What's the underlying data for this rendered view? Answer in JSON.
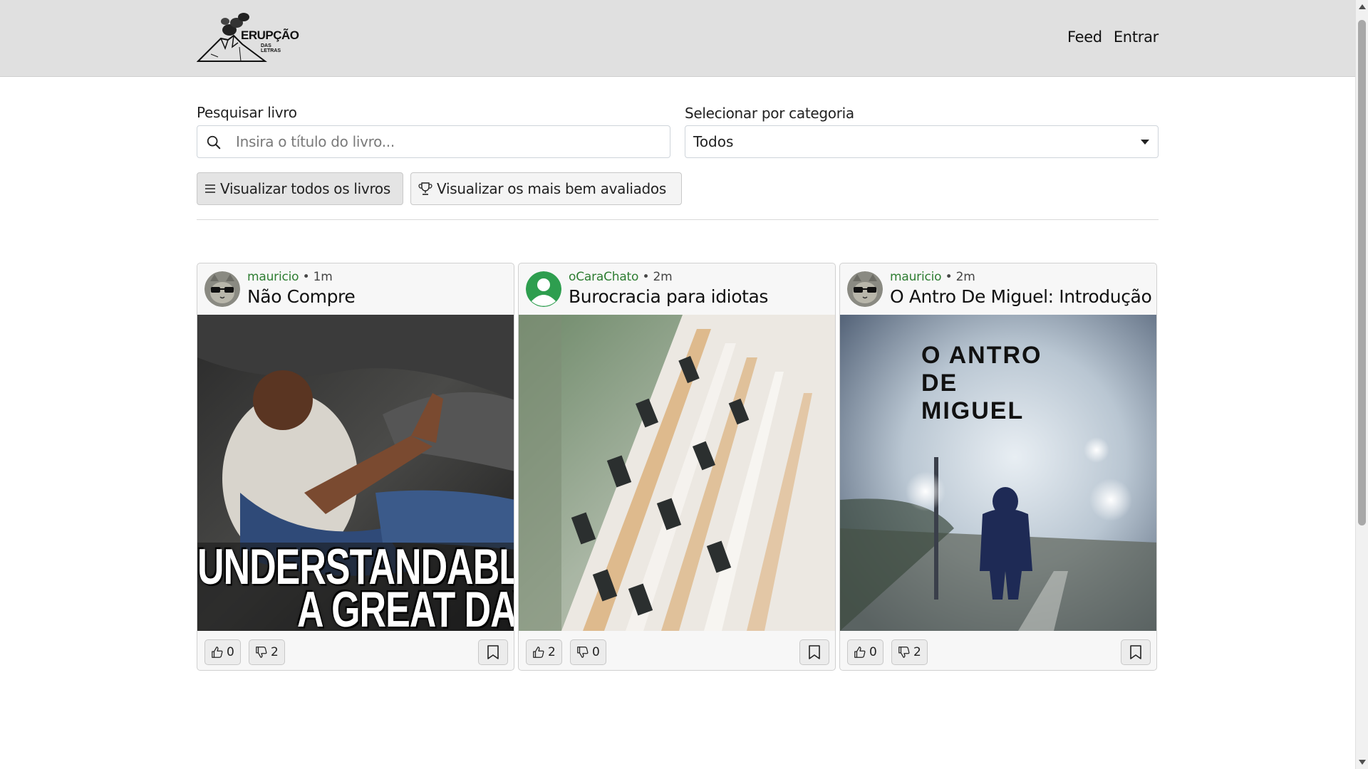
{
  "navbar": {
    "logo_text": "ERUPÇÃO",
    "logo_sub": "DAS LETRAS",
    "links": [
      {
        "label": "Feed"
      },
      {
        "label": "Entrar"
      }
    ]
  },
  "search": {
    "label": "Pesquisar livro",
    "placeholder": "Insira o título do livro...",
    "value": ""
  },
  "category": {
    "label": "Selecionar por categoria",
    "selected": "Todos"
  },
  "buttons": {
    "view_all": "Visualizar todos os livros",
    "top_rated": "Visualizar os mais bem avaliados"
  },
  "posts": [
    {
      "author": "mauricio",
      "time": "1m",
      "title": "Não Compre",
      "image_text": [
        "UNDERSTANDABLE",
        "A GREAT DAY"
      ],
      "likes": "0",
      "dislikes": "2",
      "avatar": "cat-avatar"
    },
    {
      "author": "oCaraChato",
      "time": "2m",
      "title": "Burocracia para idiotas",
      "image_text": [],
      "likes": "2",
      "dislikes": "0",
      "avatar": "default-user-avatar"
    },
    {
      "author": "mauricio",
      "time": "2m",
      "title": "O Antro De Miguel: Introdução",
      "image_text": [
        "O ANTRO\nDE\nMIGUEL"
      ],
      "likes": "0",
      "dislikes": "2",
      "avatar": "cat-avatar"
    }
  ],
  "colors": {
    "navbar_bg": "#e0e0e0",
    "author_green": "#2e7d32",
    "card_bg": "#f7f7f7",
    "default_avatar_green": "#2e9e4f"
  }
}
